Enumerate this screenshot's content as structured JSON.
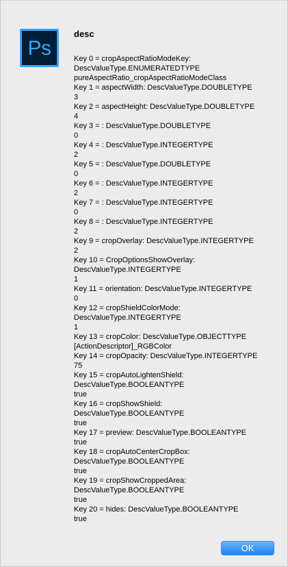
{
  "dialog": {
    "title": "desc",
    "app_icon": {
      "name": "photoshop-icon",
      "text": "Ps",
      "background": "#001d34",
      "accent": "#31a8ff"
    },
    "message_lines": [
      "Key 0 = cropAspectRatioModeKey:",
      "DescValueType.ENUMERATEDTYPE",
      "pureAspectRatio_cropAspectRatioModeClass",
      "Key 1 = aspectWidth: DescValueType.DOUBLETYPE",
      "3",
      "Key 2 = aspectHeight: DescValueType.DOUBLETYPE",
      "4",
      "Key 3 = : DescValueType.DOUBLETYPE",
      "0",
      "Key 4 = : DescValueType.INTEGERTYPE",
      "2",
      "Key 5 = : DescValueType.DOUBLETYPE",
      "0",
      "Key 6 = : DescValueType.INTEGERTYPE",
      "2",
      "Key 7 = : DescValueType.INTEGERTYPE",
      "0",
      "Key 8 = : DescValueType.INTEGERTYPE",
      "2",
      "Key 9 = cropOverlay: DescValueType.INTEGERTYPE",
      "2",
      "Key 10 = CropOptionsShowOverlay:",
      "DescValueType.INTEGERTYPE",
      "1",
      "Key 11 = orientation: DescValueType.INTEGERTYPE",
      "0",
      "Key 12 = cropShieldColorMode:",
      "DescValueType.INTEGERTYPE",
      "1",
      "Key 13 = cropColor: DescValueType.OBJECTTYPE",
      "[ActionDescriptor]_RGBColor",
      "Key 14 = cropOpacity: DescValueType.INTEGERTYPE",
      "75",
      "Key 15 = cropAutoLightenShield:",
      "DescValueType.BOOLEANTYPE",
      "true",
      "Key 16 = cropShowShield:",
      "DescValueType.BOOLEANTYPE",
      "true",
      "Key 17 = preview: DescValueType.BOOLEANTYPE",
      "true",
      "Key 18 = cropAutoCenterCropBox:",
      "DescValueType.BOOLEANTYPE",
      "true",
      "Key 19 = cropShowCroppedArea:",
      "DescValueType.BOOLEANTYPE",
      "true",
      "Key 20 = hides: DescValueType.BOOLEANTYPE",
      "true"
    ],
    "ok_label": "OK"
  },
  "colors": {
    "window_background": "#ececec",
    "text": "#000000",
    "ok_button": "#1a82fb",
    "ok_text": "#ffffff"
  }
}
